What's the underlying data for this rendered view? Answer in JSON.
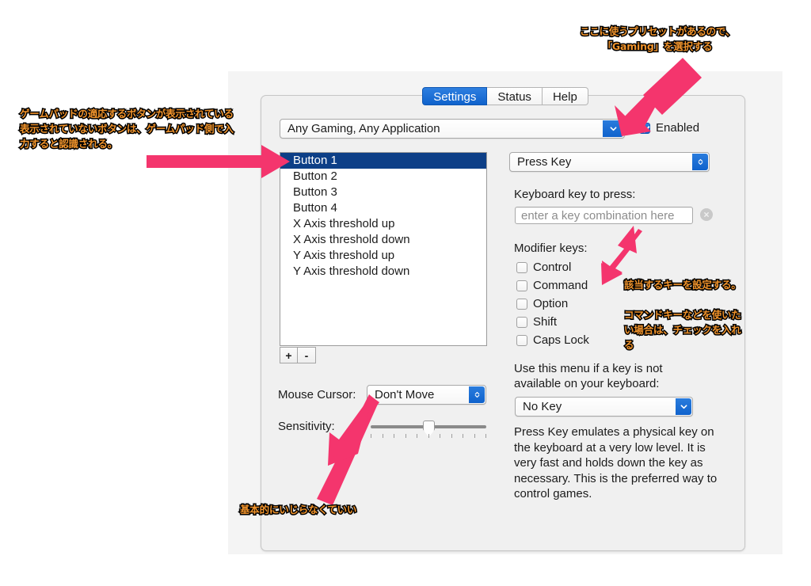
{
  "window": {
    "tabs": [
      {
        "label": "Settings",
        "active": true
      },
      {
        "label": "Status",
        "active": false
      },
      {
        "label": "Help",
        "active": false
      }
    ]
  },
  "settings": {
    "preset": {
      "value": "Any Gaming, Any Application",
      "enabled_label": "Enabled",
      "enabled_checked": true
    },
    "button_list": {
      "items": [
        "Button 1",
        "Button 2",
        "Button 3",
        "Button 4",
        "X Axis threshold up",
        "X Axis threshold down",
        "Y Axis threshold up",
        "Y Axis threshold down"
      ],
      "selected_index": 0,
      "add_label": "+",
      "remove_label": "-"
    },
    "mouse_cursor": {
      "label": "Mouse Cursor:",
      "value": "Don't Move"
    },
    "sensitivity": {
      "label": "Sensitivity:",
      "tick_count": 11,
      "value_percent": 48
    },
    "action": {
      "value": "Press Key"
    },
    "keyboard_key": {
      "label": "Keyboard key to press:",
      "value": "",
      "placeholder": "enter a key combination here",
      "clear_icon": "clear-circle-icon"
    },
    "modifiers": {
      "label": "Modifier keys:",
      "items": [
        {
          "label": "Control",
          "checked": false
        },
        {
          "label": "Command",
          "checked": false
        },
        {
          "label": "Option",
          "checked": false
        },
        {
          "label": "Shift",
          "checked": false
        },
        {
          "label": "Caps Lock",
          "checked": false
        }
      ]
    },
    "fallback_menu": {
      "label_line1": "Use this menu if a key is not",
      "label_line2": "available on your keyboard:",
      "value": "No Key"
    },
    "description": "Press Key emulates a physical key on\nthe keyboard at a very low level. It is\nvery fast and holds down the key as\nnecessary. This is the preferred way to\ncontrol games."
  },
  "annotations": {
    "top_right": "ここに使うプリセットがあるので、\n「Gaming」を選択する",
    "top_left": "ゲームパッドの適応するボタンが表示されている\n表示されていないボタンは、ゲームパッド側で入\n力すると認識される。",
    "key_field": "該当するキーを設定する。",
    "modifier_note": "コマンドキーなどを使いた\nい場合は、チェックを入れ\nる",
    "bottom": "基本的にいじらなくていい"
  },
  "colors": {
    "accent_blue": "#0f62cc",
    "selection_blue": "#0d3f87",
    "annotation_orange": "#f0932b",
    "arrow_pink": "#f4356d",
    "window_bg": "#f4f4f4",
    "panel_bg": "#f0f0f0"
  }
}
